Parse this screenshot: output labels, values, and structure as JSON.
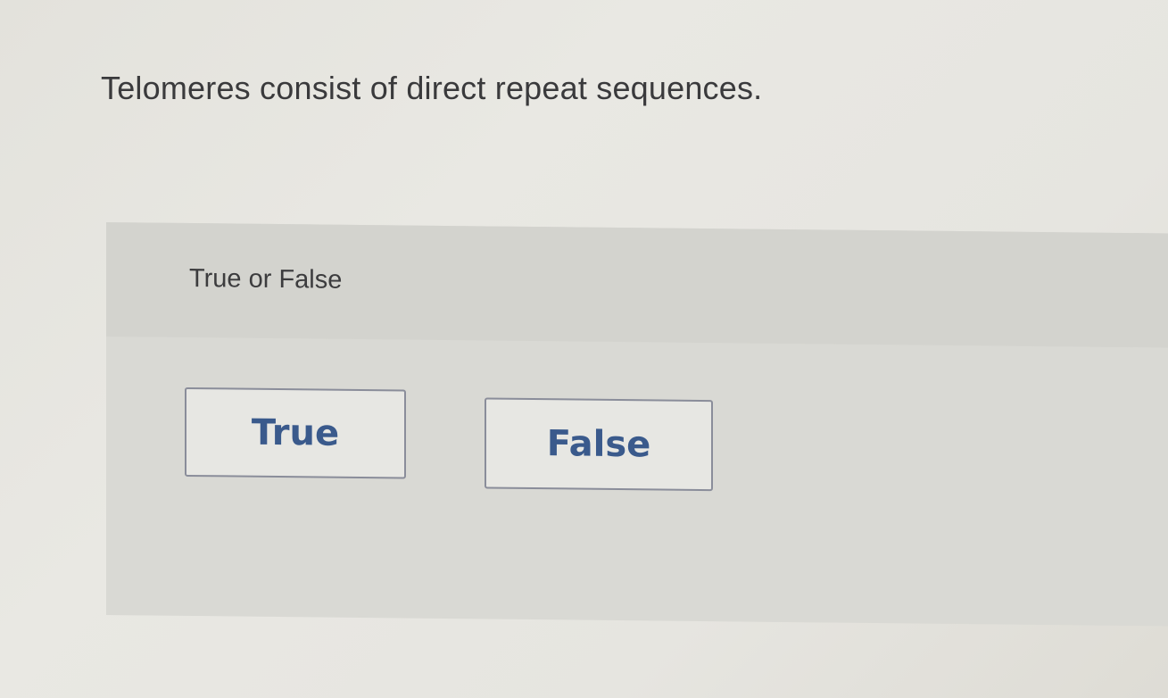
{
  "question": {
    "text": "Telomeres consist of direct repeat sequences."
  },
  "answer_panel": {
    "prompt": "True or False",
    "choices": [
      {
        "label": "True"
      },
      {
        "label": "False"
      }
    ]
  },
  "colors": {
    "button_text": "#3a5a8c",
    "button_border": "#8a8d9a",
    "panel_background": "#d9d9d4",
    "page_background": "#e6e5e0"
  }
}
